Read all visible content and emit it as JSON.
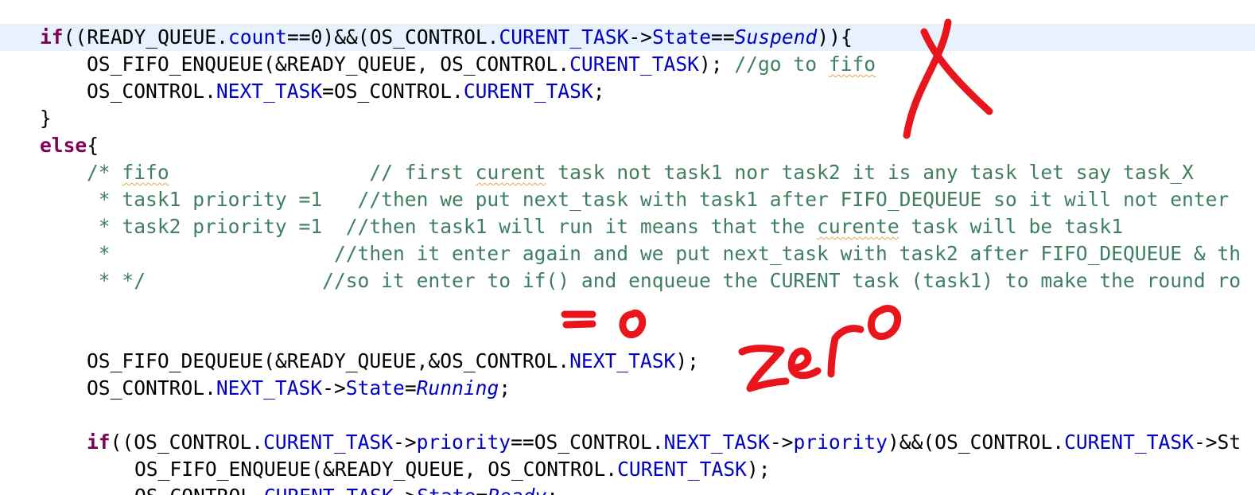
{
  "editor": {
    "lines": [
      {
        "tokens": [
          {
            "t": "if",
            "s": "kw"
          },
          {
            "t": "((READY_QUEUE.",
            "s": "p"
          },
          {
            "t": "count",
            "s": "f"
          },
          {
            "t": "==0)&&(OS_CONTROL.",
            "s": "p"
          },
          {
            "t": "CURENT_TASK",
            "s": "f"
          },
          {
            "t": "->",
            "s": "p"
          },
          {
            "t": "State",
            "s": "f"
          },
          {
            "t": "==",
            "s": "p"
          },
          {
            "t": "Suspend",
            "s": "e"
          },
          {
            "t": ")){",
            "s": "p"
          }
        ]
      },
      {
        "tokens": [
          {
            "t": "OS_FIFO_ENQUEUE(&READY_QUEUE, OS_CONTROL.",
            "s": "p"
          },
          {
            "t": "CURENT_TASK",
            "s": "f"
          },
          {
            "t": "); ",
            "s": "p"
          },
          {
            "t": "//go to ",
            "s": "c"
          },
          {
            "t": "fifo",
            "s": "c",
            "sp": true
          }
        ]
      },
      {
        "tokens": [
          {
            "t": "OS_CONTROL.",
            "s": "p"
          },
          {
            "t": "NEXT_TASK",
            "s": "f"
          },
          {
            "t": "=OS_CONTROL.",
            "s": "p"
          },
          {
            "t": "CURENT_TASK",
            "s": "f"
          },
          {
            "t": ";",
            "s": "p"
          }
        ]
      },
      {
        "tokens": [
          {
            "t": "}",
            "s": "p"
          }
        ]
      },
      {
        "tokens": [
          {
            "t": "else",
            "s": "kw"
          },
          {
            "t": "{",
            "s": "p"
          }
        ]
      },
      {
        "tokens": [
          {
            "t": "/* ",
            "s": "c"
          },
          {
            "t": "fifo",
            "s": "c",
            "sp": true
          },
          {
            "t": "                 // first ",
            "s": "c"
          },
          {
            "t": "curent",
            "s": "c",
            "sp": true
          },
          {
            "t": " task not task1 nor task2 it is any task let say task_X",
            "s": "c"
          }
        ]
      },
      {
        "tokens": [
          {
            "t": " * task1 priority =1   //then we put next_task with task1 after FIFO_DEQUEUE so it will not enter",
            "s": "c"
          }
        ]
      },
      {
        "tokens": [
          {
            "t": " * task2 priority =1  //then task1 will run it means that the ",
            "s": "c"
          },
          {
            "t": "curente",
            "s": "c",
            "sp": true
          },
          {
            "t": " task will be task1",
            "s": "c"
          }
        ]
      },
      {
        "tokens": [
          {
            "t": " *                   //then it enter again and we put next_task with task2 after FIFO_DEQUEUE & th",
            "s": "c"
          }
        ]
      },
      {
        "tokens": [
          {
            "t": " * */               //so it enter to if() and enqueue the CURENT task (task1) to make the round ro",
            "s": "c"
          }
        ]
      },
      {
        "tokens": []
      },
      {
        "tokens": []
      },
      {
        "tokens": [
          {
            "t": "OS_FIFO_DEQUEUE(&READY_QUEUE,&OS_CONTROL.",
            "s": "p"
          },
          {
            "t": "NEXT_TASK",
            "s": "f"
          },
          {
            "t": ");",
            "s": "p"
          }
        ]
      },
      {
        "tokens": [
          {
            "t": "OS_CONTROL.",
            "s": "p"
          },
          {
            "t": "NEXT_TASK",
            "s": "f"
          },
          {
            "t": "->",
            "s": "p"
          },
          {
            "t": "State",
            "s": "f"
          },
          {
            "t": "=",
            "s": "p"
          },
          {
            "t": "Running",
            "s": "e"
          },
          {
            "t": ";",
            "s": "p"
          }
        ]
      },
      {
        "tokens": []
      },
      {
        "tokens": [
          {
            "t": "if",
            "s": "kw"
          },
          {
            "t": "((OS_CONTROL.",
            "s": "p"
          },
          {
            "t": "CURENT_TASK",
            "s": "f"
          },
          {
            "t": "->",
            "s": "p"
          },
          {
            "t": "priority",
            "s": "f"
          },
          {
            "t": "==OS_CONTROL.",
            "s": "p"
          },
          {
            "t": "NEXT_TASK",
            "s": "f"
          },
          {
            "t": "->",
            "s": "p"
          },
          {
            "t": "priority",
            "s": "f"
          },
          {
            "t": ")&&(OS_CONTROL.",
            "s": "p"
          },
          {
            "t": "CURENT_TASK",
            "s": "f"
          },
          {
            "t": "->St",
            "s": "p"
          }
        ]
      },
      {
        "tokens": [
          {
            "t": "OS_FIFO_ENQUEUE(&READY_QUEUE, OS_CONTROL.",
            "s": "p"
          },
          {
            "t": "CURENT_TASK",
            "s": "f"
          },
          {
            "t": ");",
            "s": "p"
          }
        ]
      },
      {
        "tokens": [
          {
            "t": "OS_CONTROL.",
            "s": "p"
          },
          {
            "t": "CURENT_TASK",
            "s": "f"
          },
          {
            "t": "->",
            "s": "p"
          },
          {
            "t": "State",
            "s": "f"
          },
          {
            "t": "=",
            "s": "p"
          },
          {
            "t": "Ready",
            "s": "e"
          },
          {
            "t": ";",
            "s": "p"
          }
        ]
      }
    ]
  },
  "annotations": {
    "color": "#e8161c",
    "marks": [
      {
        "name": "red-x-mark",
        "text": "X"
      },
      {
        "name": "equals-zero-note",
        "text": "=0"
      },
      {
        "name": "zero-note",
        "text": "zero"
      }
    ]
  },
  "colors": {
    "keyword": "#7f0055",
    "field": "#0000c0",
    "comment": "#3f7f5f",
    "plain": "#000000",
    "current_line": "#e8f2fe",
    "spellcheck": "#e8a24c"
  }
}
